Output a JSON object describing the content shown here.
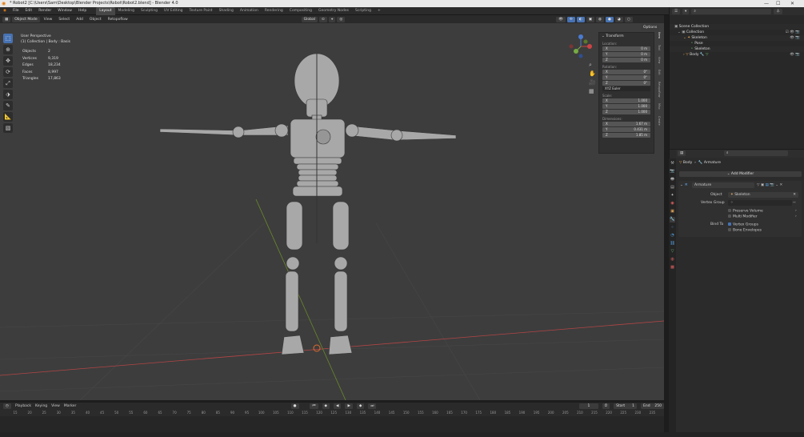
{
  "window": {
    "title": "* Robot2 [C:\\Users\\Sam\\Desktop\\Blender Projects\\Robot\\Robot2.blend] - Blender 4.0",
    "controls": [
      "—",
      "☐",
      "✕"
    ]
  },
  "menu": [
    "File",
    "Edit",
    "Render",
    "Window",
    "Help"
  ],
  "workspaces": [
    "Layout",
    "Modeling",
    "Sculpting",
    "UV Editing",
    "Texture Paint",
    "Shading",
    "Animation",
    "Rendering",
    "Compositing",
    "Geometry Nodes",
    "Scripting"
  ],
  "active_workspace": "Layout",
  "scene": {
    "label": "Scene",
    "view_layer": "ViewLayer"
  },
  "viewport_header": {
    "mode": "Object Mode",
    "menus": [
      "View",
      "Select",
      "Add",
      "Object"
    ],
    "retopo": "Retopoflow",
    "orientation": "Global",
    "options": "Options"
  },
  "stats": {
    "view": "User Perspective",
    "collection": "(1) Collection | Body : Basis",
    "rows": [
      {
        "k": "Objects",
        "v": "2"
      },
      {
        "k": "Vertices",
        "v": "9,319"
      },
      {
        "k": "Edges",
        "v": "18,234"
      },
      {
        "k": "Faces",
        "v": "8,997"
      },
      {
        "k": "Triangles",
        "v": "17,863"
      }
    ]
  },
  "npanel": {
    "header": "Transform",
    "location_label": "Location:",
    "location": [
      {
        "k": "X",
        "v": "0 m"
      },
      {
        "k": "Y",
        "v": "0 m"
      },
      {
        "k": "Z",
        "v": "0 m"
      }
    ],
    "rotation_label": "Rotation:",
    "rotation": [
      {
        "k": "X",
        "v": "0°"
      },
      {
        "k": "Y",
        "v": "0°"
      },
      {
        "k": "Z",
        "v": "0°"
      }
    ],
    "rotation_mode": "XYZ Euler",
    "scale_label": "Scale:",
    "scale": [
      {
        "k": "X",
        "v": "1.000"
      },
      {
        "k": "Y",
        "v": "1.000"
      },
      {
        "k": "Z",
        "v": "1.000"
      }
    ],
    "dimensions_label": "Dimensions:",
    "dimensions": [
      {
        "k": "X",
        "v": "1.67 m"
      },
      {
        "k": "Y",
        "v": "0.431 m"
      },
      {
        "k": "Z",
        "v": "1.85 m"
      }
    ],
    "tabs": [
      "Item",
      "Tool",
      "View",
      "Edit",
      "Retopoflow",
      "Misc",
      "Create"
    ]
  },
  "timeline": {
    "menus": [
      "Playback",
      "Keying",
      "View",
      "Marker"
    ],
    "current_frame": "1",
    "start_label": "Start",
    "start": "1",
    "end_label": "End",
    "end": "250",
    "ticks": [
      "15",
      "20",
      "25",
      "30",
      "35",
      "40",
      "45",
      "50",
      "55",
      "60",
      "65",
      "70",
      "75",
      "80",
      "85",
      "90",
      "95",
      "100",
      "105",
      "110",
      "115",
      "120",
      "125",
      "130",
      "135",
      "140",
      "145",
      "150",
      "155",
      "160",
      "165",
      "170",
      "175",
      "180",
      "185",
      "190",
      "195",
      "200",
      "205",
      "210",
      "215",
      "220",
      "225",
      "230",
      "235"
    ]
  },
  "outliner": {
    "rows": [
      {
        "label": "Scene Collection",
        "indent": 0
      },
      {
        "label": "Collection",
        "indent": 1
      },
      {
        "label": "Skeleton",
        "indent": 2
      },
      {
        "label": "Pose",
        "indent": 3
      },
      {
        "label": "Skeleton",
        "indent": 3
      },
      {
        "label": "Body",
        "indent": 2
      }
    ]
  },
  "properties": {
    "breadcrumb_object": "Body",
    "breadcrumb_modifier": "Armature",
    "add_modifier": "Add Modifier",
    "modifier_name": "Armature",
    "object_label": "Object",
    "object_value": "Skeleton",
    "vertex_group_label": "Vertex Group",
    "preserve_volume": "Preserve Volume",
    "multi_modifier": "Multi Modifier",
    "bind_to_label": "Bind To",
    "vertex_groups": "Vertex Groups",
    "bone_envelopes": "Bone Envelopes"
  },
  "colors": {
    "accent": "#4772b3",
    "viewport_bg": "#3d3d3d",
    "axis_x": "#b34545",
    "axis_y": "#6a8a2a"
  }
}
